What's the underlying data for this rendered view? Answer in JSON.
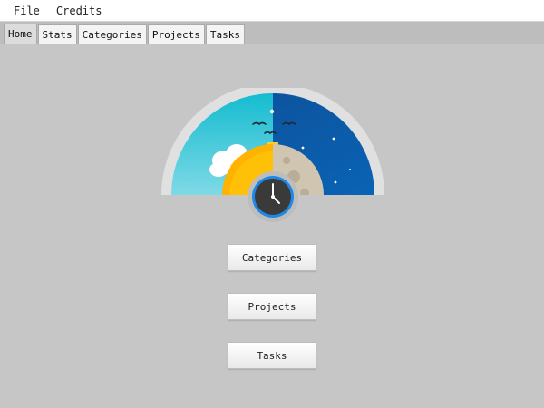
{
  "menu": {
    "items": [
      "File",
      "Credits"
    ]
  },
  "tabs": {
    "items": [
      "Home",
      "Stats",
      "Categories",
      "Projects",
      "Tasks"
    ],
    "active": "Home"
  },
  "home": {
    "buttons": {
      "categories": "Categories",
      "projects": "Projects",
      "tasks": "Tasks"
    }
  },
  "theme": {
    "background": "#c6c6c6",
    "day_sky": "#2bbfd0",
    "night_sky": "#0a5aa6",
    "sun": "#ffb300",
    "clock_face": "#3a3a3a",
    "clock_ring": "#1e88e5"
  }
}
